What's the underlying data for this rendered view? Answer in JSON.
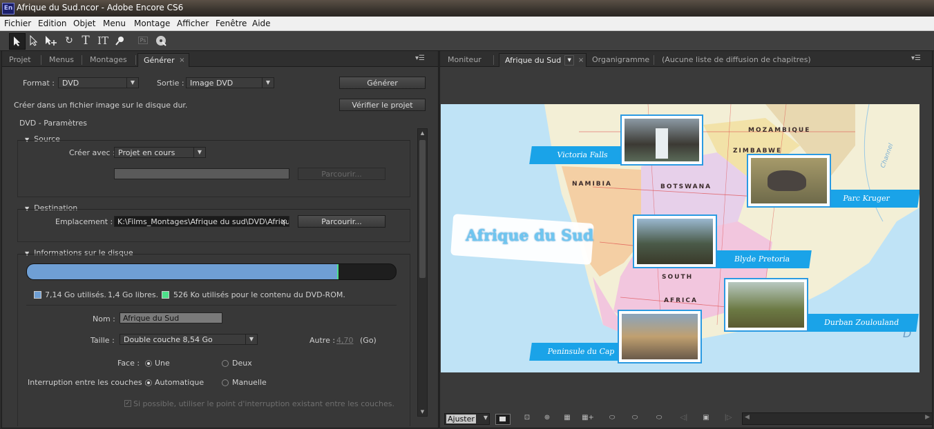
{
  "window": {
    "title": "Afrique du Sud.ncor - Adobe Encore CS6",
    "app_badge": "En"
  },
  "menu": [
    "Fichier",
    "Edition",
    "Objet",
    "Menu",
    "Montage",
    "Afficher",
    "Fenêtre",
    "Aide"
  ],
  "toolbar": {
    "tools": [
      "selection-tool",
      "direct-select-tool",
      "move-tool",
      "rotate-tool",
      "text-tool",
      "vertical-text-tool",
      "zoom-tool",
      "photoshop-tool",
      "preview-tool"
    ],
    "text_glyph": "T",
    "vertical_text_glyph": "IT",
    "ps_glyph": "Ps"
  },
  "left_panel": {
    "tabs": [
      "Projet",
      "Menus",
      "Montages",
      "Générer"
    ],
    "active_tab": "Générer",
    "format_label": "Format :",
    "format_value": "DVD",
    "output_label": "Sortie :",
    "output_value": "Image DVD",
    "build_button": "Générer",
    "check_button": "Vérifier le projet",
    "description": "Créer dans un fichier image sur le disque dur.",
    "params_title": "DVD - Paramètres",
    "source": {
      "header": "Source",
      "create_with_label": "Créer avec :",
      "create_with_value": "Projet en cours",
      "browse_button": "Parcourir..."
    },
    "destination": {
      "header": "Destination",
      "location_label": "Emplacement :",
      "location_value": "K:\\Films_Montages\\Afrique du sud\\DVD\\Afrique c",
      "browse_button": "Parcourir..."
    },
    "disk_info": {
      "header": "Informations sur le disque",
      "used_fraction": 0.841,
      "dvdrom_fraction": 0.004,
      "used_text": "7,14 Go utilisés.",
      "free_text": "1,4 Go libres.",
      "dvdrom_text": "526 Ko utilisés pour le contenu du DVD-ROM.",
      "used_color": "#6f9fd4",
      "dvdrom_color": "#4ce08a",
      "name_label": "Nom :",
      "name_value": "Afrique du Sud",
      "size_label": "Taille :",
      "size_value": "Double couche 8,54 Go",
      "other_label": "Autre :",
      "other_value": "4,70",
      "other_unit": "(Go)",
      "face_label": "Face :",
      "face_options": [
        "Une",
        "Deux"
      ],
      "face_selected": "Une",
      "layer_break_label": "Interruption entre les couches :",
      "layer_break_options": [
        "Automatique",
        "Manuelle"
      ],
      "layer_break_selected": "Automatique",
      "existing_break_label": "Si possible, utiliser le point d'interruption existant entre les couches."
    }
  },
  "right_panel": {
    "tabs": [
      "Moniteur",
      "Afrique du Sud",
      "Organigramme",
      "(Aucune liste de diffusion de chapitres)"
    ],
    "active_tab": "Afrique du Sud",
    "menu_preview": {
      "title": "Afrique du Sud",
      "buttons": [
        "Victoria Falls",
        "Parc Kruger",
        "Blyde  Pretoria",
        "Durban  Zoulouland",
        "Peninsule du Cap"
      ],
      "map_labels": [
        "MOZAMBIQUE",
        "ZIMBABWE",
        "NAMIBIA",
        "BOTSWANA",
        "SOUTH",
        "AFRICA"
      ],
      "map_extra_labels": [
        "D",
        "Channel"
      ],
      "accent_color": "#1aa3e8"
    },
    "zoom_label": "Ajuster"
  }
}
